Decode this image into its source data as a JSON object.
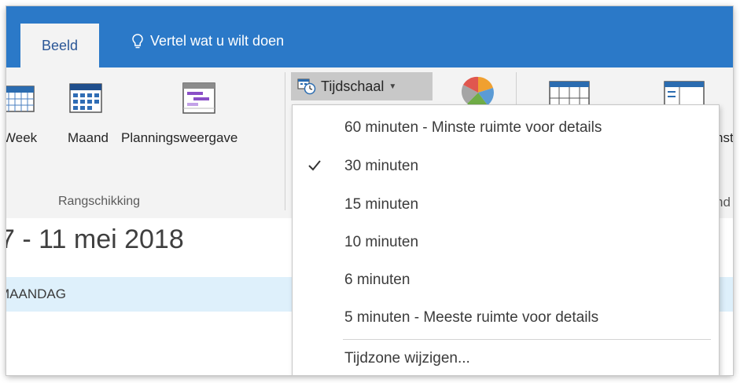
{
  "tabs": {
    "active": "Beeld",
    "tell_me": "Vertel wat u wilt doen"
  },
  "ribbon": {
    "week": "Week",
    "month": "Maand",
    "schedule": "Planningsweergave",
    "group_label": "Rangschikking",
    "timescale": "Tijdschaal",
    "right_partial_1": "nst",
    "right_partial_2": "nd"
  },
  "timescale_menu": {
    "items": [
      {
        "label": "60 minuten - Minste ruimte voor details",
        "checked": false
      },
      {
        "label": "30 minuten",
        "checked": true
      },
      {
        "label": "15 minuten",
        "checked": false
      },
      {
        "label": "10 minuten",
        "checked": false
      },
      {
        "label": "6 minuten",
        "checked": false
      },
      {
        "label": "5 minuten - Meeste ruimte voor details",
        "checked": false
      }
    ],
    "change_timezone": "Tijdzone wijzigen..."
  },
  "calendar": {
    "date_range": "7 - 11 mei 2018",
    "day_header": "MAANDAG"
  },
  "colors": {
    "tab_bar": "#2b79c8",
    "ribbon_bg": "#f3f3f3",
    "day_band": "#def0fb",
    "active_tab_text": "#2b5797"
  },
  "icons": [
    "lightbulb-icon",
    "calendar-week-icon",
    "calendar-month-icon",
    "schedule-view-icon",
    "timescale-icon",
    "color-pie-icon",
    "grid-layout-icon",
    "panel-layout-icon",
    "checkmark-icon"
  ]
}
